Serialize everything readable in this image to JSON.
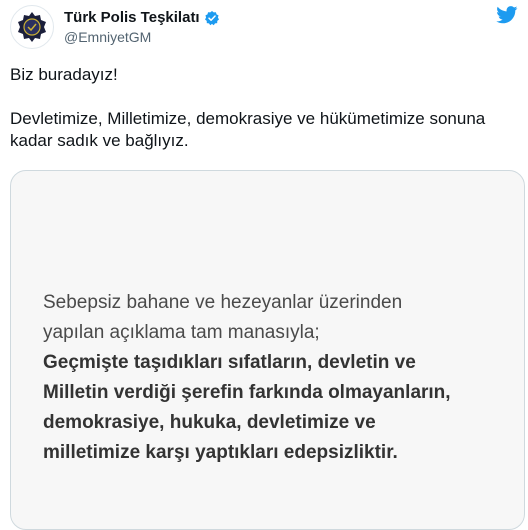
{
  "account": {
    "display_name": "Türk Polis Teşkilatı",
    "handle": "@EmniyetGM",
    "verified": true,
    "avatar_icon": "police-badge-icon"
  },
  "tweet": {
    "paragraphs": [
      "Biz buradayız!",
      "Devletimize, Milletimize, demokrasiye ve hükümetimize sonuna kadar sadık ve bağlıyız."
    ]
  },
  "media": {
    "intro_lines": [
      "Sebepsiz bahane ve hezeyanlar üzerinden",
      "yapılan açıklama tam manasıyla;"
    ],
    "bold_lines": [
      "Geçmişte taşıdıkları sıfatların, devletin ve",
      "Milletin verdiği şerefin farkında olmayanların,",
      "demokrasiye, hukuka, devletimize ve",
      "milletimize karşı yaptıkları edepsizliktir."
    ]
  },
  "colors": {
    "twitter_blue": "#1d9bf0",
    "text": "#0f1419",
    "muted": "#536471"
  }
}
